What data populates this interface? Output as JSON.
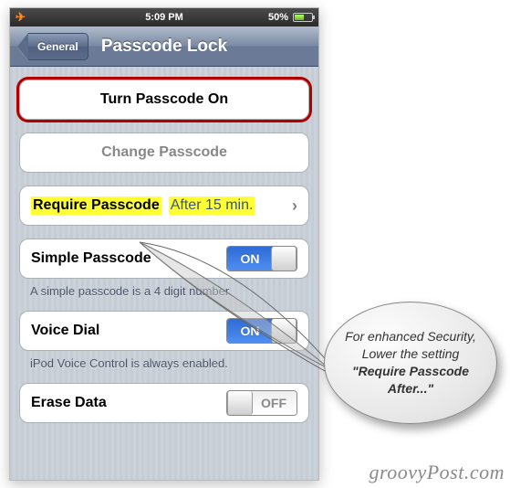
{
  "status": {
    "time": "5:09 PM",
    "battery_pct": "50%"
  },
  "nav": {
    "back_label": "General",
    "title": "Passcode Lock"
  },
  "cells": {
    "turn_passcode_on": "Turn Passcode On",
    "change_passcode": "Change Passcode",
    "require_passcode_label": "Require Passcode",
    "require_passcode_value": "After 15 min.",
    "simple_passcode": "Simple Passcode",
    "simple_passcode_footer": "A simple passcode is a 4 digit number.",
    "voice_dial": "Voice Dial",
    "voice_dial_footer": "iPod Voice Control is always enabled.",
    "erase_data": "Erase Data"
  },
  "toggle": {
    "on_label": "ON",
    "off_label": "OFF"
  },
  "callout": {
    "line1": "For enhanced Security, Lower the setting ",
    "bold": "\"Require Passcode After...\""
  },
  "watermark": "groovyPost.com"
}
